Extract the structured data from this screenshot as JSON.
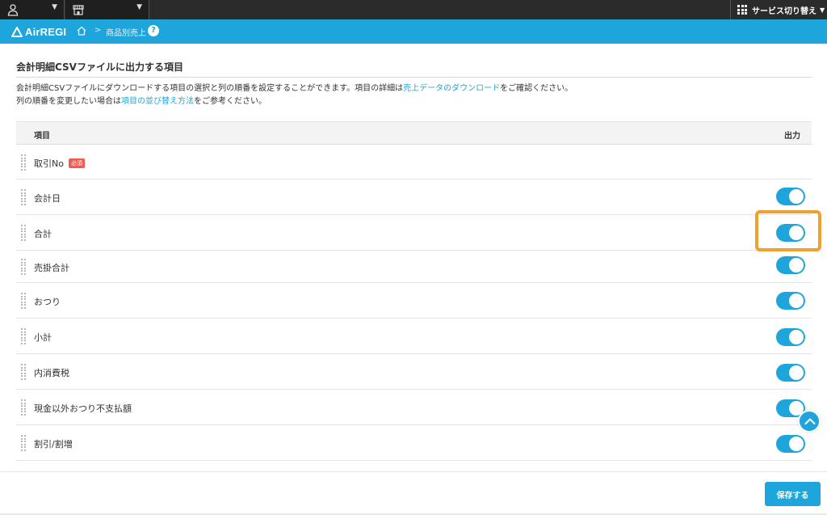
{
  "topbar": {
    "service_switch_label": "サービス切り替え"
  },
  "header": {
    "logo_text": "AirREGI",
    "breadcrumb": "商品別売上",
    "help_label": "?"
  },
  "section": {
    "title": "会計明細CSVファイルに出力する項目",
    "desc1_pre": "会計明細CSVファイルにダウンロードする項目の選択と列の順番を設定することができます。項目の詳細は",
    "desc1_link": "売上データのダウンロード",
    "desc1_post": "をご確認ください。",
    "desc2_pre": "列の順番を変更したい場合は",
    "desc2_link": "項目の並び替え方法",
    "desc2_post": "をご参考ください。"
  },
  "table": {
    "col_item": "項目",
    "col_output": "出力",
    "required_badge": "必須",
    "rows": [
      {
        "label": "取引No",
        "required": true
      },
      {
        "label": "会計日",
        "output": true
      },
      {
        "label": "合計",
        "output": true
      },
      {
        "label": "売掛合計",
        "output": true
      },
      {
        "label": "おつり",
        "output": true
      },
      {
        "label": "小計",
        "output": true
      },
      {
        "label": "内消費税",
        "output": true
      },
      {
        "label": "現金以外おつり不支払額",
        "output": true
      },
      {
        "label": "割引/割増",
        "output": true
      }
    ]
  },
  "footer": {
    "save_label": "保存する"
  },
  "colors": {
    "accent": "#1ea5dc",
    "highlight": "#f0a02c",
    "required": "#f35a4c"
  }
}
